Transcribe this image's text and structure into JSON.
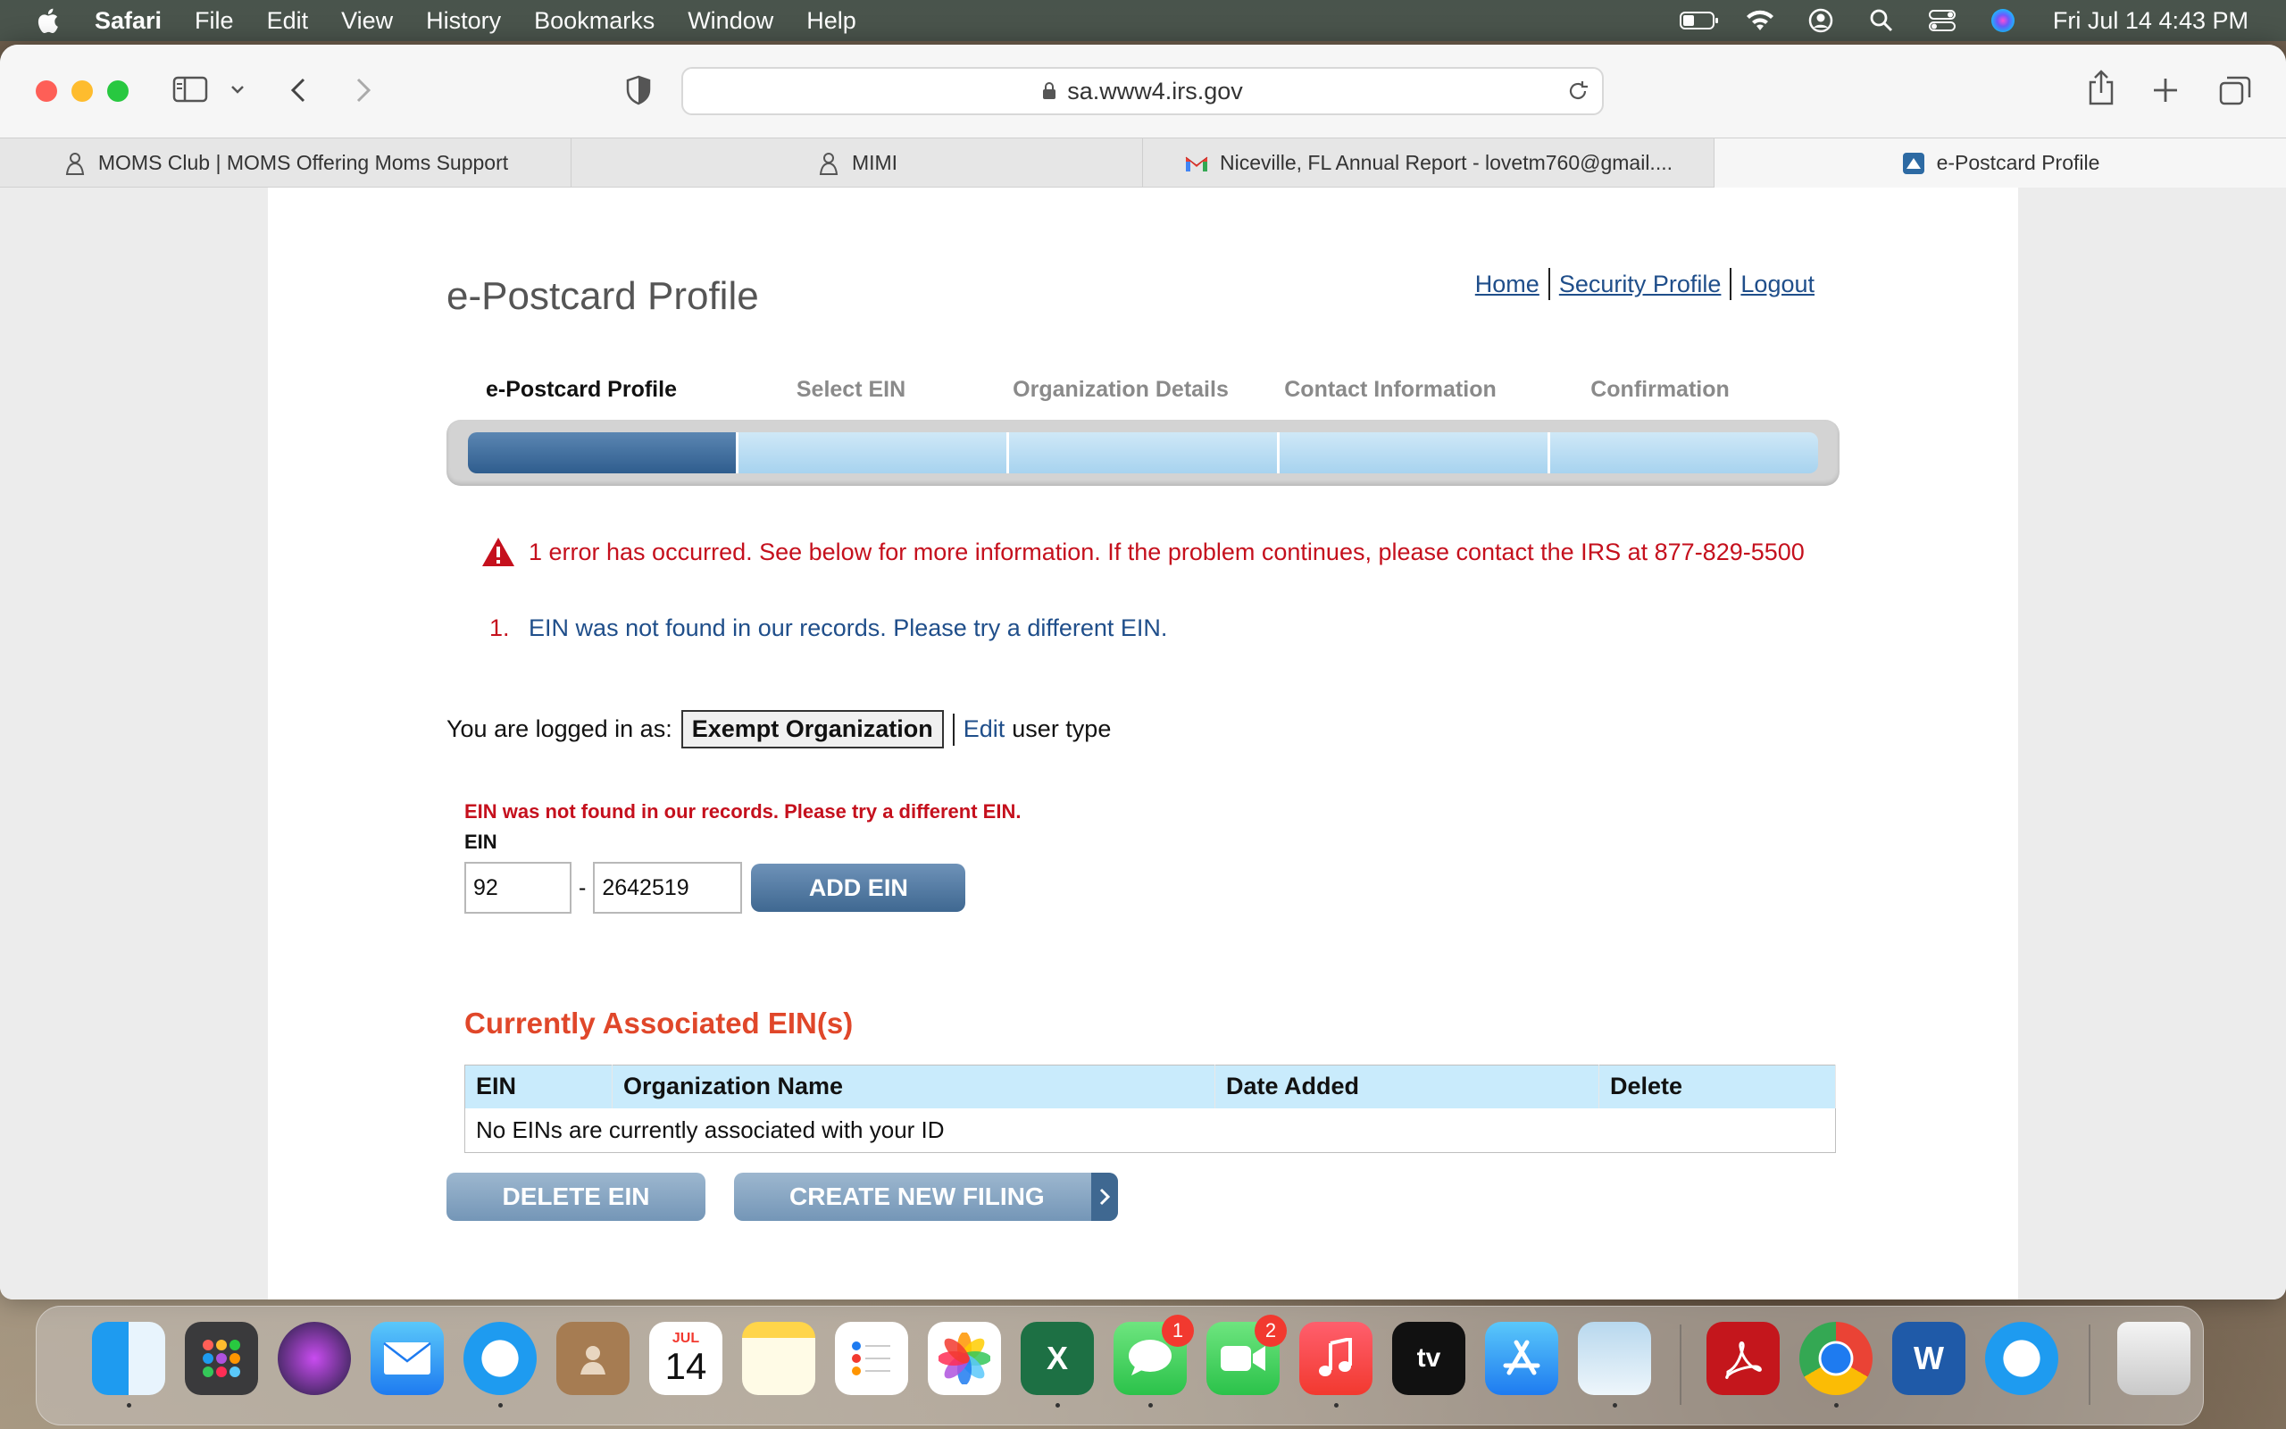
{
  "menubar": {
    "app_name": "Safari",
    "items": [
      "File",
      "Edit",
      "View",
      "History",
      "Bookmarks",
      "Window",
      "Help"
    ],
    "clock": "Fri Jul 14  4:43 PM"
  },
  "browser": {
    "url": "sa.www4.irs.gov",
    "tabs": [
      {
        "title": "MOMS Club | MOMS Offering Moms Support",
        "icon": "moms-club-favicon"
      },
      {
        "title": "MIMI",
        "icon": "moms-club-favicon"
      },
      {
        "title": "Niceville, FL Annual Report - lovetm760@gmail....",
        "icon": "gmail-favicon"
      },
      {
        "title": "e-Postcard Profile",
        "icon": "irs-favicon",
        "active": true
      }
    ]
  },
  "page": {
    "title": "e-Postcard Profile",
    "links": {
      "home": "Home",
      "security": "Security Profile",
      "logout": "Logout"
    },
    "steps": [
      "e-Postcard Profile",
      "Select EIN",
      "Organization Details",
      "Contact Information",
      "Confirmation"
    ],
    "active_step": 0,
    "error_banner": "1 error has occurred. See below for more information. If the problem continues, please contact the IRS at 877-829-5500",
    "errors": [
      {
        "num": "1.",
        "text": "EIN was not found in our records. Please try a different EIN."
      }
    ],
    "logged_in": {
      "label": "You are logged in as:",
      "user_type": "Exempt Organization",
      "edit": "Edit",
      "suffix": "user type"
    },
    "ein_form": {
      "error": "EIN was not found in our records. Please try a different EIN.",
      "label": "EIN",
      "prefix_value": "92",
      "dash": "-",
      "suffix_value": "2642519",
      "add_button": "ADD EIN"
    },
    "associated": {
      "title": "Currently Associated EIN(s)",
      "headers": [
        "EIN",
        "Organization Name",
        "Date Added",
        "Delete"
      ],
      "empty_message": "No EINs are currently associated with your ID"
    },
    "buttons": {
      "delete": "DELETE EIN",
      "create": "CREATE NEW FILING"
    }
  },
  "dock": {
    "badges": {
      "messages": "1",
      "facetime": "2"
    },
    "calendar": {
      "month": "JUL",
      "day": "14"
    },
    "word_label": "W",
    "excel_label": "X",
    "tv_label": "tv"
  },
  "colors": {
    "error_red": "#c5101d",
    "link_blue": "#1f4e8a",
    "section_title": "#e0472a",
    "table_header": "#c9ebfc"
  }
}
